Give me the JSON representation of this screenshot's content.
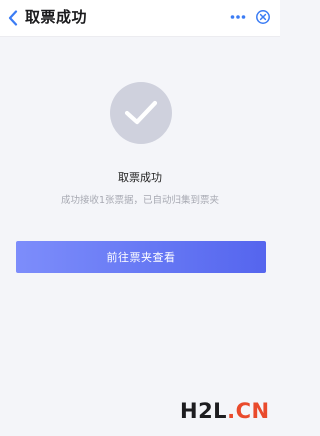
{
  "header": {
    "title": "取票成功",
    "back_icon": "chevron-left-icon",
    "more_icon": "more-dots-icon",
    "close_icon": "close-circle-icon"
  },
  "result": {
    "icon": "checkmark-icon",
    "title": "取票成功",
    "description": "成功接收1张票据，已自动归集到票夹"
  },
  "actions": {
    "primary_label": "前往票夹查看"
  },
  "watermark": {
    "left": "H2L",
    "dot": ".",
    "right": "CN"
  },
  "colors": {
    "accent": "#3b7cf4",
    "button_gradient_start": "#7d8dfb",
    "button_gradient_end": "#5565ee",
    "success_circle": "#cfd1dd",
    "watermark_red": "#e94a2c"
  }
}
